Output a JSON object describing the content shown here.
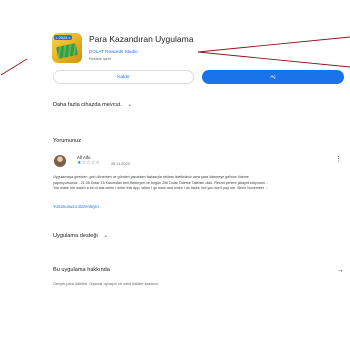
{
  "app": {
    "title": "Para Kazandıran Uygulama",
    "developer": "DOLAT Rewards Studio",
    "meta": "Reklam içerir",
    "icon_badge": "• 2024 •",
    "icon": "app-icon-money"
  },
  "actions": {
    "secondary_label": "Kaldır",
    "primary_label": "Aç"
  },
  "devices": {
    "label": "Daha fazla cihazda mevcut.",
    "icon": "chevron-down-icon"
  },
  "reviews": {
    "heading": "Yorumunuz",
    "review": {
      "author": "Alf Alfu",
      "rating": 1,
      "max_rating": 5,
      "date": "25.11.2023",
      "lines": [
        "Uygulamaya girerken ,geri dönerken ve gönderi yaparken fazlasıyla reklam izlettirdiniz ama para ödemeye gelince ödeme",
        "yapmıyorsunuz . 21.35 Dolar 15 Kasımdan beri Bekleyen ve bugün 250 Dolar Ödeme Talebim oldu. Resmi yerlere şikayet ediyorum...",
        "You make me watch a lot of ads when I enter this App, when I go back and when I do tasks, but you don't pay me. Since November ..."
      ],
      "edit_label": "Yorumunuzu düzenleyin"
    }
  },
  "support": {
    "label": "Uygulama desteği",
    "icon": "chevron-down-icon"
  },
  "about": {
    "label": "Bu uygulama hakkında",
    "description": "Gerçek para ödülleri. Oyunlar oynayın ve nakit ödüller kazanın.",
    "icon": "arrow-right-icon"
  },
  "colors": {
    "accent": "#1a73e8",
    "annotation_arrow": "#8b1a1a"
  }
}
